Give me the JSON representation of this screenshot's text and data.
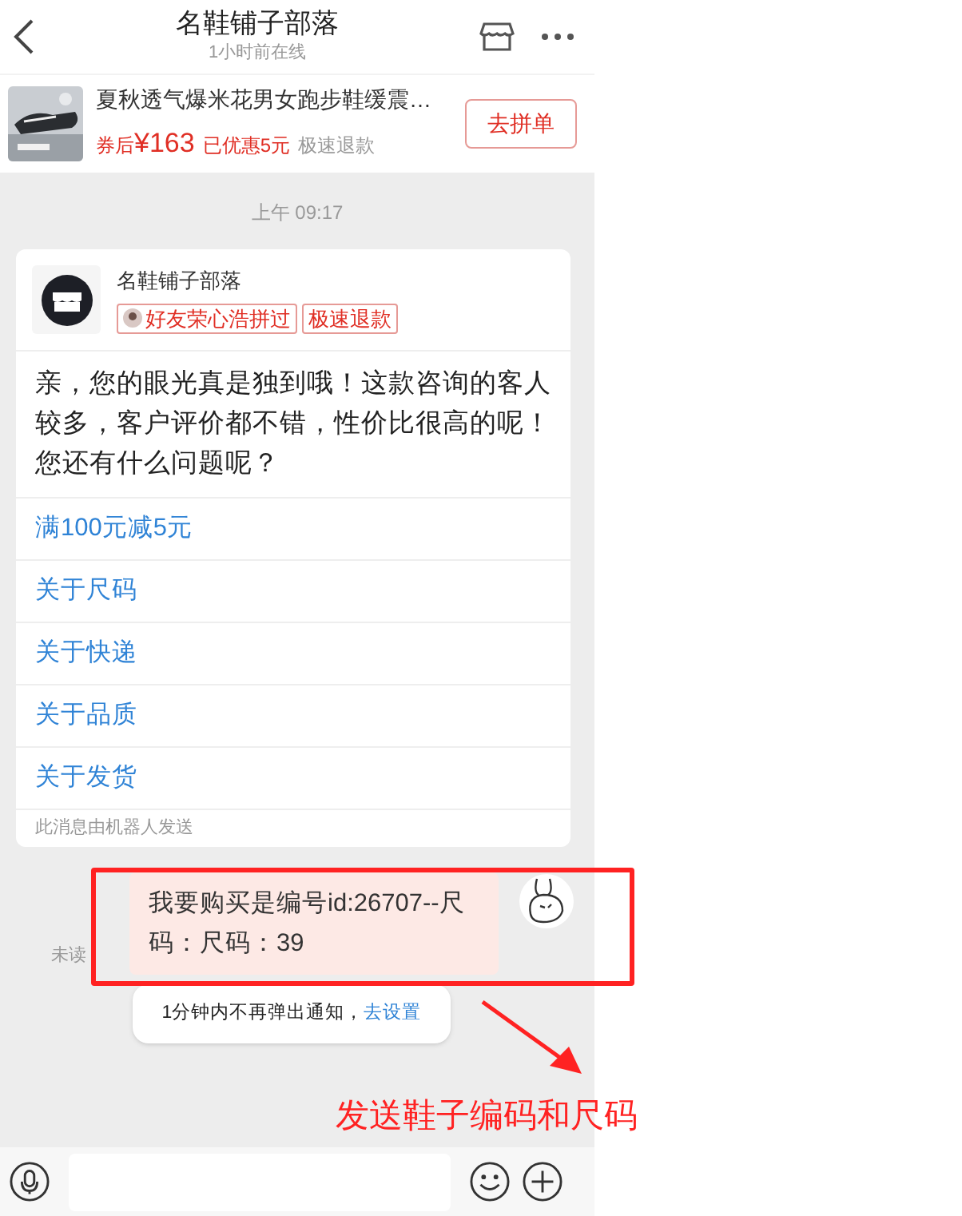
{
  "header": {
    "title": "名鞋铺子部落",
    "subtitle": "1小时前在线"
  },
  "product": {
    "title": "夏秋透气爆米花男女跑步鞋缓震…",
    "price_prefix": "券后",
    "price": "¥163",
    "discount": "已优惠5元",
    "service": "极速退款",
    "button": "去拼单"
  },
  "time": "上午 09:17",
  "robot_card": {
    "shop_name": "名鞋铺子部落",
    "tags": [
      {
        "kind": "friend",
        "text": "好友荣心浩拼过"
      },
      {
        "kind": "plain",
        "text": "极速退款"
      }
    ],
    "message": "亲，您的眼光真是独到哦！这款咨询的客人较多，客户评价都不错，性价比很高的呢！您还有什么问题呢？",
    "options": [
      "满100元减5元",
      "关于尺码",
      "关于快递",
      "关于品质",
      "关于发货"
    ],
    "footer": "此消息由机器人发送"
  },
  "my_message": {
    "text": "我要购买是编号id:26707--尺码：尺码：39",
    "status": "未读"
  },
  "toast": {
    "text": "1分钟内不再弹出通知，",
    "link": "去设置"
  },
  "annotation": {
    "caption": "发送鞋子编码和尺码"
  }
}
